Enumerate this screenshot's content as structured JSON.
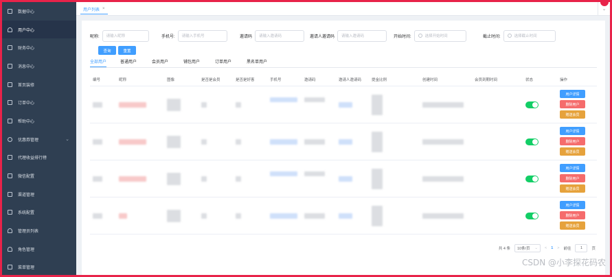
{
  "sidebar": {
    "items": [
      {
        "label": "数据中心",
        "icon": "square-icon"
      },
      {
        "label": "用户中心",
        "icon": "user-icon",
        "active": true
      },
      {
        "label": "财务中心",
        "icon": "wallet-icon"
      },
      {
        "label": "消息中心",
        "icon": "message-icon"
      },
      {
        "label": "首页装修",
        "icon": "box-icon"
      },
      {
        "label": "订单中心",
        "icon": "order-icon"
      },
      {
        "label": "帮助中心",
        "icon": "help-icon"
      },
      {
        "label": "优惠券管理",
        "icon": "coupon-icon",
        "expandable": true
      },
      {
        "label": "代理收益排行榜",
        "icon": "yen-icon"
      },
      {
        "label": "微信配置",
        "icon": "wechat-icon"
      },
      {
        "label": "渠道管理",
        "icon": "channel-icon"
      },
      {
        "label": "系统配置",
        "icon": "settings-list-icon"
      },
      {
        "label": "管理员列表",
        "icon": "admin-icon"
      },
      {
        "label": "角色管理",
        "icon": "role-icon"
      },
      {
        "label": "菜单管理",
        "icon": "menu-list-icon"
      }
    ]
  },
  "tabs": {
    "active_label": "用户列表",
    "close": "×",
    "more": "⌄"
  },
  "filters": {
    "nickname": {
      "label": "昵称:",
      "placeholder": "请输入昵称"
    },
    "phone": {
      "label": "手机号:",
      "placeholder": "请输入手机号"
    },
    "invite_code": {
      "label": "邀请码",
      "placeholder": "请输入邀请码"
    },
    "inviter_code": {
      "label": "邀请人邀请码",
      "placeholder": "请输入邀请码"
    },
    "start_time": {
      "label": "开始时间:",
      "placeholder": "选择开始时间"
    },
    "end_time": {
      "label": "截止时间:",
      "placeholder": "选择截止时间"
    },
    "search_button": "查询",
    "reset_button": "重置"
  },
  "user_tabs": [
    "全部用户",
    "普通用户",
    "会员用户",
    "铺包用户",
    "订单用户",
    "黑名单用户"
  ],
  "table": {
    "columns": [
      "编号",
      "昵称",
      "图像",
      "是否是会员",
      "是否是好客",
      "手机号",
      "邀请码",
      "邀请人邀请码",
      "提金比例",
      "创建时间",
      "会员到期时间",
      "状态",
      "操作"
    ],
    "row_count": 4,
    "actions": {
      "detail": "用户详情",
      "delete": "删除用户",
      "member": "赠送会员"
    },
    "status_on": true
  },
  "pagination": {
    "total": "共 4 条",
    "page_size": "10条/页",
    "prev": "<",
    "current_page": "1",
    "next": ">",
    "goto_label": "前往",
    "goto_value": "1",
    "page_suffix": "页"
  },
  "colors": {
    "sidebar": "#2f3f52",
    "primary": "#409eff",
    "danger": "#f56c6c",
    "warning": "#e6a23c",
    "success": "#13ce66",
    "frame": "#e8234a"
  },
  "watermark": "CSDN @小李探花码农"
}
